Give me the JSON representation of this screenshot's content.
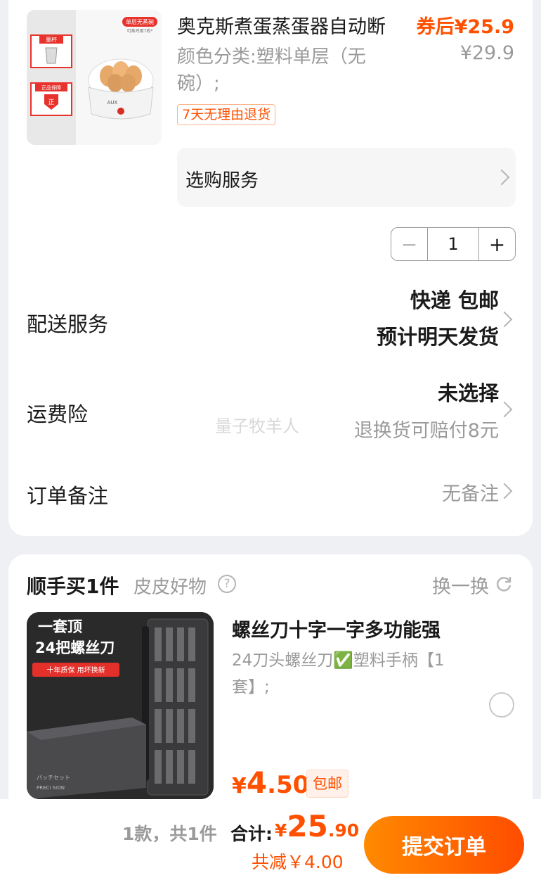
{
  "product1": {
    "title": "奥克斯煮蛋蒸蛋器自动断",
    "sku": "颜色分类:塑料单层（无碗）;",
    "price_after_coupon": "券后¥25.9",
    "original_price": "¥29.9",
    "return_tag": "7天无理由退货",
    "image_labels": {
      "top_badge": "单层无蒸碗",
      "top_badge_sub": "可蒸鸡蛋7枚*",
      "cup_label": "量杯",
      "guarantee_label": "正品保障",
      "guarantee_mark": "正",
      "brand": "AUX"
    }
  },
  "service_option": {
    "label": "选购服务"
  },
  "quantity": {
    "minus": "−",
    "value": "1",
    "plus": "+"
  },
  "delivery": {
    "label": "配送服务",
    "line1": "快递 包邮",
    "line2": "预计明天发货"
  },
  "shipping_insurance": {
    "label": "运费险",
    "value": "未选择",
    "note": "退换货可赔付8元"
  },
  "order_note": {
    "label": "订单备注",
    "value": "无备注"
  },
  "watermark": "量子牧羊人",
  "addon": {
    "title": "顺手买1件",
    "subtitle": "皮皮好物",
    "help_glyph": "?",
    "swap_label": "换一换",
    "product": {
      "title": "螺丝刀十字一字多功能强",
      "sku": "24刀头螺丝刀✅塑料手柄【1套】;",
      "price_symbol": "¥",
      "price_int": "4",
      "price_dec": ".50",
      "free_shipping": "包邮",
      "image_labels": {
        "line1": "一套顶",
        "line2": "24把螺丝刀",
        "banner": "十年质保  用坏换新",
        "case_text1": "パッチセット",
        "case_text2": "PRECI SION"
      }
    }
  },
  "bottom_bar": {
    "count": "1款，共1件",
    "total_label": "合计:",
    "total_symbol": "¥",
    "total_int": "25",
    "total_dec": ".90",
    "saved": "共减￥4.00",
    "submit": "提交订单"
  },
  "colors": {
    "accent": "#ff5000",
    "muted": "#9a9a9a",
    "background": "#eef0f4"
  }
}
